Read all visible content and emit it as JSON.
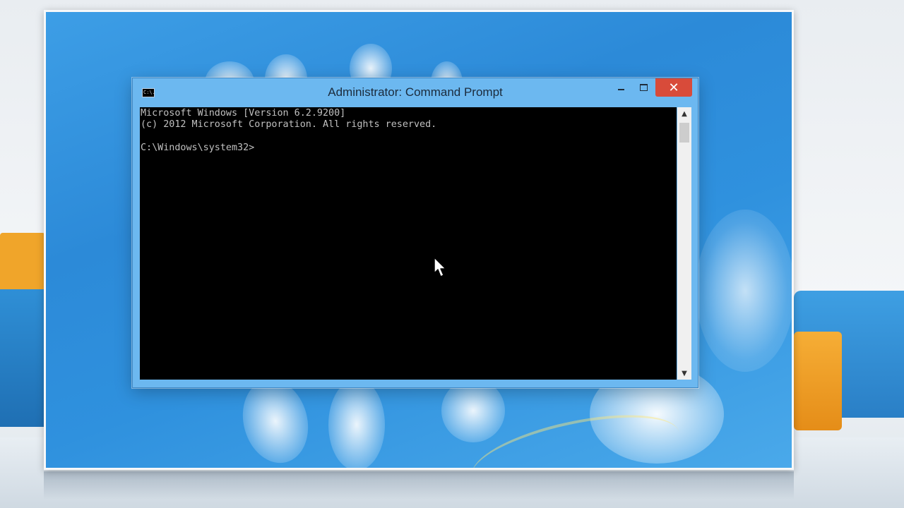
{
  "window": {
    "title": "Administrator: Command Prompt",
    "icon_text": "C:\\.",
    "close_glyph": "✕"
  },
  "console": {
    "lines": [
      "Microsoft Windows [Version 6.2.9200]",
      "(c) 2012 Microsoft Corporation. All rights reserved.",
      "",
      "C:\\Windows\\system32>"
    ]
  },
  "scrollbar": {
    "up_glyph": "▲",
    "down_glyph": "▼"
  },
  "icons": {
    "app": "cmd-icon",
    "minimize": "minimize-icon",
    "maximize": "maximize-icon",
    "close": "close-icon",
    "cursor": "mouse-pointer-icon"
  },
  "colors": {
    "desktop": "#2c8ad8",
    "titlebar": "#6cb8f0",
    "close_button": "#d84b3a",
    "console_bg": "#000000",
    "console_text": "#c0c0c0"
  }
}
